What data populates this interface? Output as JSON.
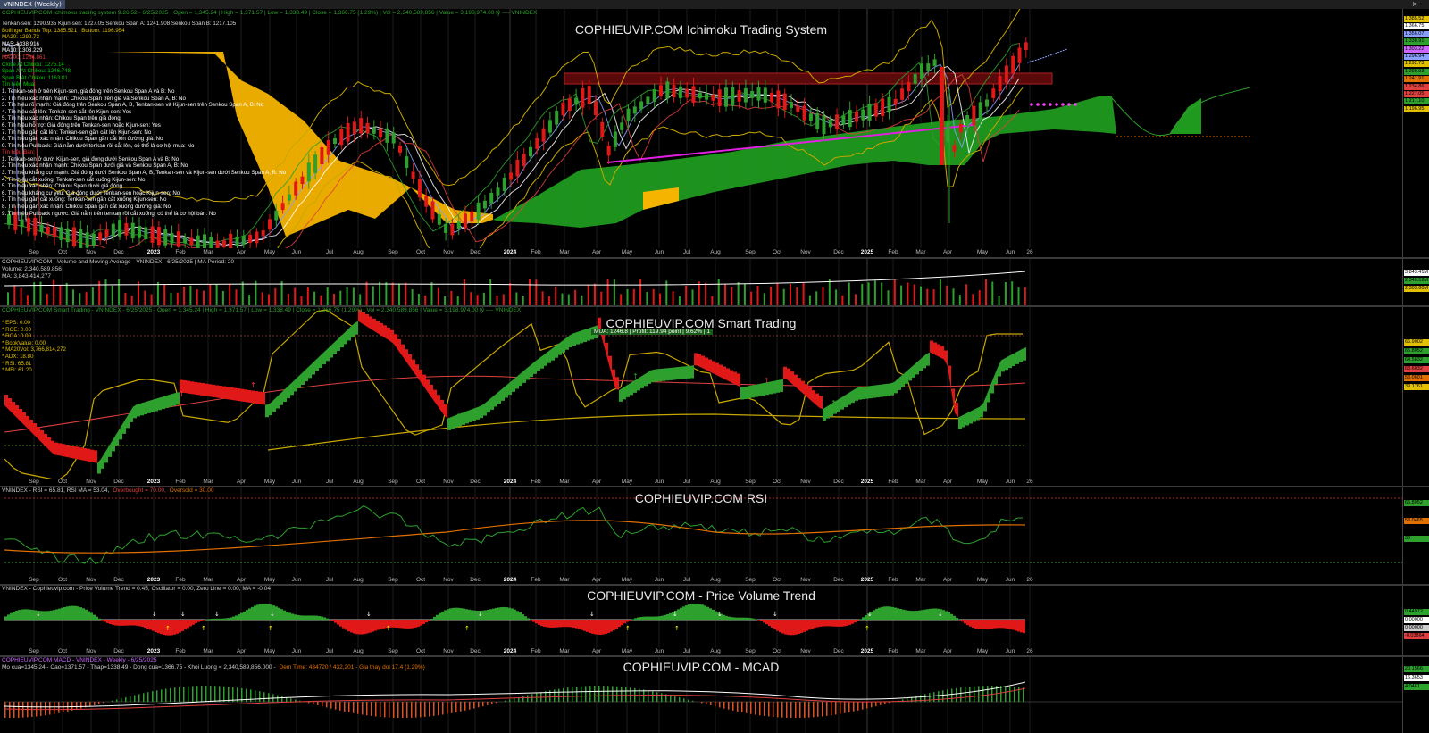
{
  "window": {
    "tab_title": "VNINDEX (Weekly)",
    "close_glyph": "×"
  },
  "colors": {
    "up": "#2ea02e",
    "down": "#e01818",
    "kumo_bull": "#1f9a1f",
    "kumo_bear": "#f5b400"
  },
  "x_axis_1": [
    "Sep",
    "Oct",
    "Nov",
    "Dec",
    "2023",
    "Feb",
    "Mar",
    "Apr",
    "May",
    "Jun",
    "Jul",
    "Aug",
    "Sep",
    "Oct",
    "Nov",
    "Dec",
    "2024",
    "Feb",
    "Mar",
    "Apr",
    "May",
    "Jun",
    "Jul",
    "Aug",
    "Sep",
    "Oct",
    "Nov",
    "Dec",
    "2025",
    "Feb",
    "Mar",
    "Apr",
    "May",
    "Jun",
    "26"
  ],
  "x_axis_2": [
    "Sep",
    "Oct",
    "Nov",
    "Dec",
    "2023",
    "Feb",
    "Mar",
    "Apr",
    "May",
    "Jun",
    "Jul",
    "Aug",
    "Sep",
    "Oct",
    "Nov",
    "Dec",
    "2024",
    "Feb",
    "Mar",
    "Apr",
    "May",
    "Jun",
    "Jul",
    "Aug",
    "Sep",
    "Oct",
    "Nov",
    "Dec",
    "2025",
    "Feb",
    "Mar",
    "Apr",
    "May",
    "Jun",
    "26"
  ],
  "pane1": {
    "header": "COPHIEUVIP.COM Ichimoku trading system 9.26.52 - 6/25/2025 · Open = 1,345.24 | High = 1,371.57 | Low = 1,338.49 | Close = 1,366.75 (1.29%) | Vol = 2,340,589,856 | Value = 3,198,974.00 tỷ ---- VNINDEX",
    "title": "COPHIEUVIP.COM Ichimoku Trading System",
    "indicators": [
      {
        "text": "Tenkan-sen: 1290.935  Kijun-sen: 1227.05  Senkou Span A: 1241.908  Senkou Span B: 1217.105",
        "color": "#d8d8d8"
      },
      {
        "text": "Bollinger Bands Top: 1385.521 | Bottom: 1196.954",
        "color": "#e0c000"
      },
      {
        "text": "MA20: 1292.73",
        "color": "#e0c000"
      },
      {
        "text": "MA5: 1338.916",
        "color": "#ffffff"
      },
      {
        "text": "MA10: 1303.229",
        "color": "#ffffff"
      },
      {
        "text": "MA200: 1234.861",
        "color": "#e04040"
      },
      {
        "text": "Close At Chikou: 1275.14",
        "color": "#00d000"
      },
      {
        "text": "Span A At Chikou: 1246.748",
        "color": "#00d000"
      },
      {
        "text": "Span B At Chikou: 1163.01",
        "color": "#00d000"
      },
      {
        "text": "Tín hiệu Mua:",
        "color": "#00d000"
      },
      {
        "text": "1. Tenkan-sen ở trên Kijun-sen, giá đóng trên Senkou Span A và B: No",
        "color": "#ffffff"
      },
      {
        "text": "2. Tín hiệu xác nhận mạnh: Chikou Span trên giá và Senkou Span A, B: No",
        "color": "#ffffff"
      },
      {
        "text": "3. Tín hiệu rõ mạnh: Giá đóng trên Senkou Span A, B, Tenkan-sen và Kijun-sen trên Senkou Span A, B: No",
        "color": "#ffffff"
      },
      {
        "text": "4. Tín hiệu cắt lên: Tenkan-sen cắt lên Kijun-sen: Yes",
        "color": "#ffffff"
      },
      {
        "text": "5. Tín hiệu xác nhận: Chikou Span trên giá đóng",
        "color": "#ffffff"
      },
      {
        "text": "6. Tín hiệu hỗ trợ: Giá đóng trên Tenkan-sen hoặc Kijun-sen: Yes",
        "color": "#ffffff"
      },
      {
        "text": "7. Tín hiệu gần cắt lên: Tenkan-sen gần cắt lên Kijun-sen: No",
        "color": "#ffffff"
      },
      {
        "text": "8. Tín hiệu gần xác nhận: Chikou Span gần cắt lên đường giá: No",
        "color": "#ffffff"
      },
      {
        "text": "9. Tín hiệu Pullback: Giá nằm dưới tenkan rồi cắt lên, có thể là cơ hội mua: No",
        "color": "#ffffff"
      },
      {
        "text": "Tín hiệu Bán:",
        "color": "#ff3030"
      },
      {
        "text": "1. Tenkan-sen ở dưới Kijun-sen, giá đóng dưới Senkou Span A và B: No",
        "color": "#ffffff"
      },
      {
        "text": "2. Tín hiệu xác nhận mạnh: Chikou Span dưới giá và Senkou Span A, B: No",
        "color": "#ffffff"
      },
      {
        "text": "3. Tín hiệu khẳng cự mạnh: Giá đóng dưới Senkou Span A, B, Tenkan-sen và Kijun-sen dưới Senkou Span A, B: No",
        "color": "#ffffff"
      },
      {
        "text": "4. Tín hiệu cắt xuống: Tenkan-sen cắt xuống Kijun-sen: No",
        "color": "#ffffff"
      },
      {
        "text": "5. Tín hiệu xác nhận: Chikou Span dưới giá đóng",
        "color": "#ffffff"
      },
      {
        "text": "6. Tín hiệu kháng cự yếu: Giá đóng dưới Tenkan-sen hoặc Kijun-sen: No",
        "color": "#ffffff"
      },
      {
        "text": "7. Tín hiệu gần cắt xuống: Tenkan-sen gần cắt xuống Kijun-sen: No",
        "color": "#ffffff"
      },
      {
        "text": "8. Tín hiệu gần xác nhận: Chikou Span gần cắt xuống đường giá: No",
        "color": "#ffffff"
      },
      {
        "text": "9. Tín hiệu Pullback ngược: Giá nằm trên tenkan rồi cắt xuống, có thể là cơ hội bán: No",
        "color": "#ffffff"
      }
    ],
    "price_tags": [
      {
        "text": "1,385.52",
        "color": "#e0c000"
      },
      {
        "text": "1,366.75",
        "color": "#ffffff"
      },
      {
        "text": "1,356.07",
        "color": "#8aa0ff"
      },
      {
        "text": "1,338.91",
        "color": "#2ea02e"
      },
      {
        "text": "1,303.22",
        "color": "#cc66ff"
      },
      {
        "text": "1,296.94",
        "color": "#8aa0ff"
      },
      {
        "text": "1,292.73",
        "color": "#e0c000"
      },
      {
        "text": "1,290.93",
        "color": "#2ea02e"
      },
      {
        "text": "1,241.91",
        "color": "#e07000"
      },
      {
        "text": "1,234.86",
        "color": "#e04040"
      },
      {
        "text": "1,227.05",
        "color": "#e04040"
      },
      {
        "text": "1,217.10",
        "color": "#2ea02e"
      },
      {
        "text": "1,196.95",
        "color": "#e0c000"
      }
    ]
  },
  "pane2": {
    "header": "COPHIEUVIP.COM - Volume and Moving Average · VNINDEX · 6/25/2025 | MA Period: 20",
    "line2": "Volume: 2,340,589,856",
    "line3": "MA: 3,843,414,277",
    "tags": [
      {
        "text": "3,843.41M",
        "color": "#ffffff"
      },
      {
        "text": "2,340.59M",
        "color": "#2ea02e"
      },
      {
        "text": "2,303.60M",
        "color": "#e0c000"
      }
    ]
  },
  "pane3": {
    "header": "COPHIEUVIP.COM Smart Trading - VNINDEX - 6/25/2025 - Open = 1,345.24 | High = 1,371.57 | Low = 1,338.49 | Close = 1,366.75 (1.29%) | Vol = 2,340,589,856 | Value = 3,198,974.00 tỷ ---- VNINDEX",
    "title": "COPHIEUVIP.COM Smart Trading",
    "badge": "MUA: 1246.8 | Profit: 119.94 point | 9.62% | 1",
    "stats": [
      {
        "label": "* EPS:",
        "value": "0.00"
      },
      {
        "label": "* ROE:",
        "value": "0.00"
      },
      {
        "label": "* ROA:",
        "value": "0.00"
      },
      {
        "label": "* BookValue:",
        "value": "0.00"
      },
      {
        "label": "* MA20Vol:",
        "value": "3,766,814,272"
      },
      {
        "label": "* ADX:",
        "value": "18.80"
      },
      {
        "label": "* RSI:",
        "value": "65.81"
      },
      {
        "label": "* MFI:",
        "value": "61.20"
      }
    ],
    "tags": [
      {
        "text": "66.9002",
        "color": "#e0c000"
      },
      {
        "text": "65.8052",
        "color": "#2ea02e"
      },
      {
        "text": "64.5832",
        "color": "#2ea02e"
      },
      {
        "text": "63.6032",
        "color": "#e04040"
      },
      {
        "text": "53.0601",
        "color": "#e07000"
      },
      {
        "text": "39.1761",
        "color": "#e0c000"
      }
    ]
  },
  "pane4": {
    "header_parts": [
      {
        "text": "VNINDEX - RSI = 65.81, RSI MA = 53.04,",
        "color": "#cccccc"
      },
      {
        "text": "Overbought = 70.00,",
        "color": "#e04040"
      },
      {
        "text": "Oversold = 30.00",
        "color": "#e07000"
      }
    ],
    "title": "COPHIEUVIP.COM RSI",
    "tags": [
      {
        "text": "65.8052",
        "color": "#2ea02e"
      },
      {
        "text": "53.0465",
        "color": "#e07000"
      },
      {
        "text": "30",
        "color": "#2ea02e"
      }
    ]
  },
  "pane5": {
    "header": "VNINDEX - Cophieuvip.com - Price Volume Trend = 0.45, Oscillator = 0.00, Zero Line = 0.00, MA = -0.04",
    "title": "COPHIEUVIP.COM - Price Volume Trend",
    "tags": [
      {
        "text": "0.44972",
        "color": "#2ea02e"
      },
      {
        "text": "0.00000",
        "color": "#ffffff"
      },
      {
        "text": "0.00000",
        "color": "#cccccc"
      },
      {
        "text": "-0.03864",
        "color": "#e04040"
      }
    ]
  },
  "pane6": {
    "header": "COPHIEUVIP.COM MACD - VNINDEX - Weekly - 6/25/2025",
    "line2_parts": [
      {
        "text": "Mo cua=1345.24 - Cao=1371.57 - Thap=1338.49 - Dong cua=1366.75 - Khoi Luong = 2,340,589,856.000 -",
        "color": "#cccccc"
      },
      {
        "text": "Dem Time: 434720 / 432,201 - Gia thay doi 17.4 (1.29%)",
        "color": "#e07000"
      }
    ],
    "title": "COPHIEUVIP.COM - MCAD",
    "tags": [
      {
        "text": "20.1566",
        "color": "#2ea02e"
      },
      {
        "text": "16.3653",
        "color": "#ffffff"
      },
      {
        "text": "4.0461",
        "color": "#2ea02e"
      }
    ]
  }
}
